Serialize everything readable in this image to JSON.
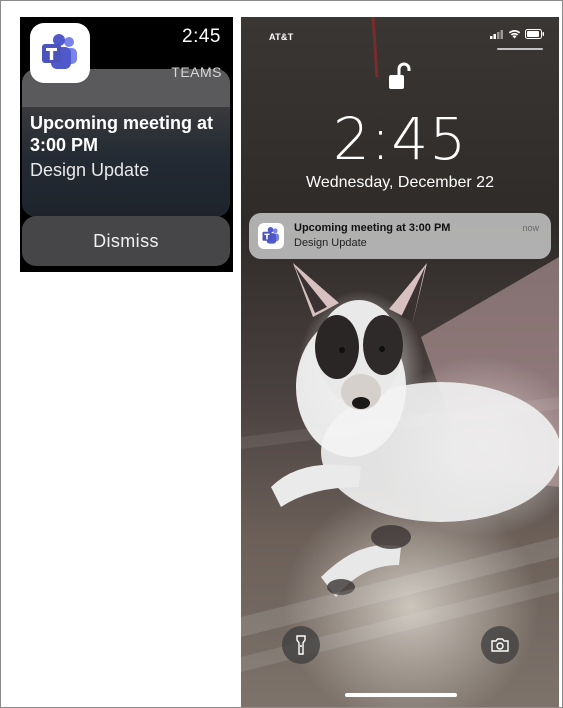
{
  "watch": {
    "time": "2:45",
    "app_name": "TEAMS",
    "title": "Upcoming meeting at 3:00 PM",
    "subtitle": "Design Update",
    "dismiss_label": "Dismiss",
    "app_icon": "teams-icon"
  },
  "phone": {
    "carrier": "AT&T",
    "status_icons": [
      "signal-icon",
      "wifi-icon",
      "battery-icon"
    ],
    "lock_state_icon": "unlocked-padlock-icon",
    "time": "2:45",
    "date": "Wednesday, December 22",
    "notification": {
      "app_icon": "teams-icon",
      "title": "Upcoming meeting at 3:00 PM",
      "subtitle": "Design Update",
      "time": "now"
    },
    "flashlight_icon": "flashlight-icon",
    "camera_icon": "camera-icon"
  },
  "colors": {
    "teams_purple": "#5059C9",
    "teams_purple_light": "#7B83EB"
  }
}
